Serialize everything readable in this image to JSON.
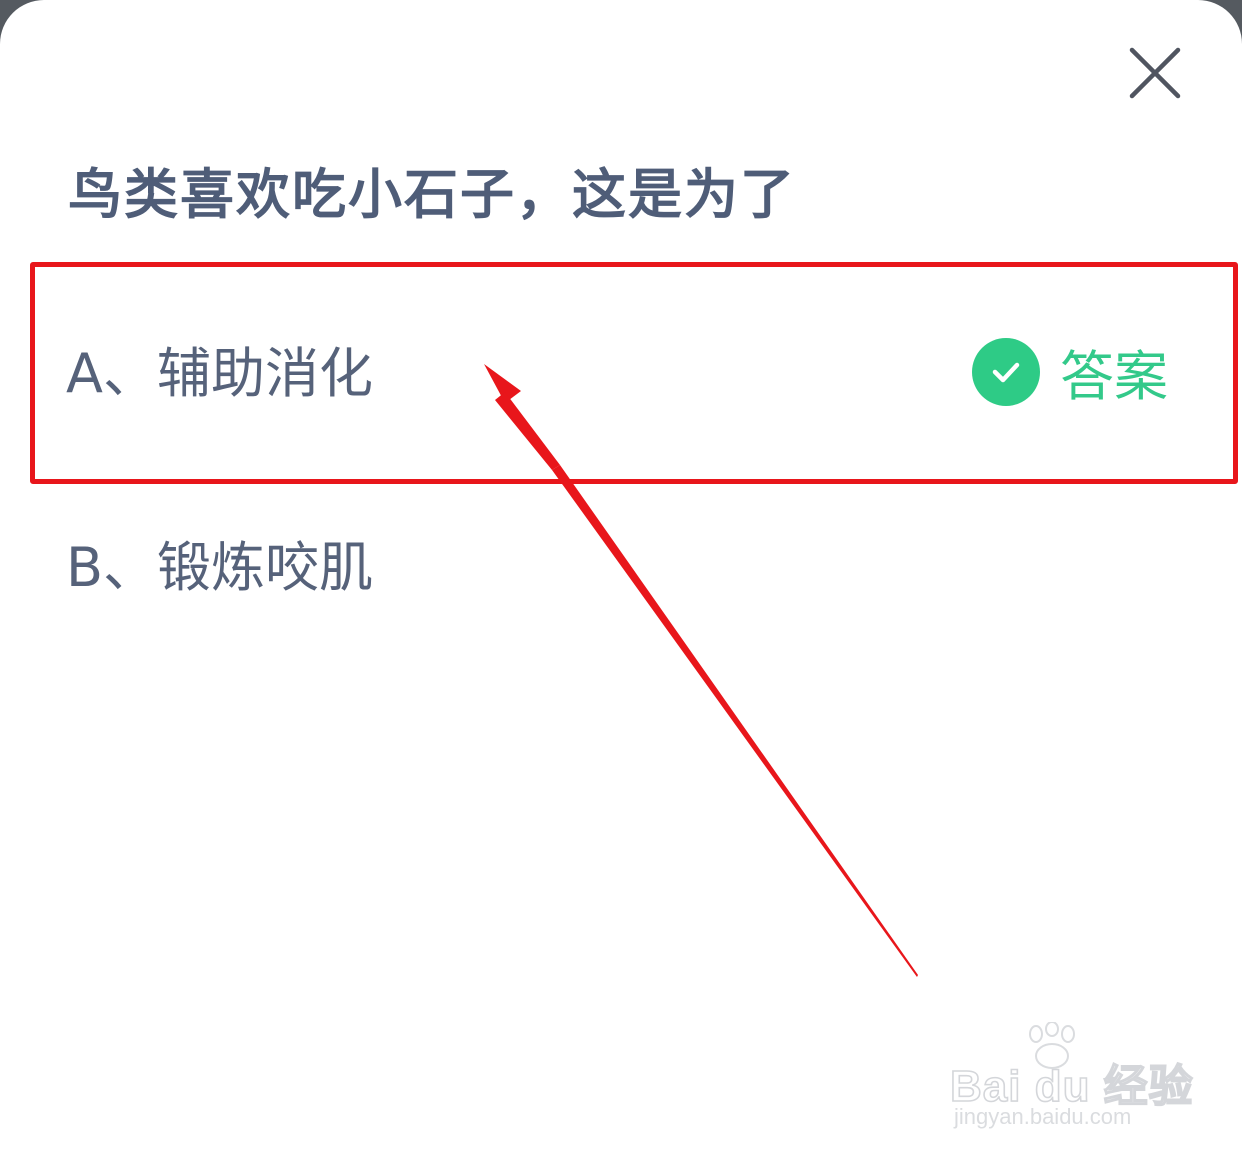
{
  "dialog": {
    "close_icon": "close-icon",
    "question": "鸟类喜欢吃小石子，这是为了",
    "options": [
      {
        "label": "A、辅助消化",
        "is_answer": true
      },
      {
        "label": "B、锻炼咬肌",
        "is_answer": false
      }
    ],
    "answer_badge": {
      "icon": "check-circle-icon",
      "text": "答案",
      "color": "#2ecb86"
    }
  },
  "annotation": {
    "highlight_color": "#e8161b",
    "arrow_icon": "red-arrow"
  },
  "watermark": {
    "logo_text": "Bai du 经验",
    "url": "jingyan.baidu.com"
  }
}
